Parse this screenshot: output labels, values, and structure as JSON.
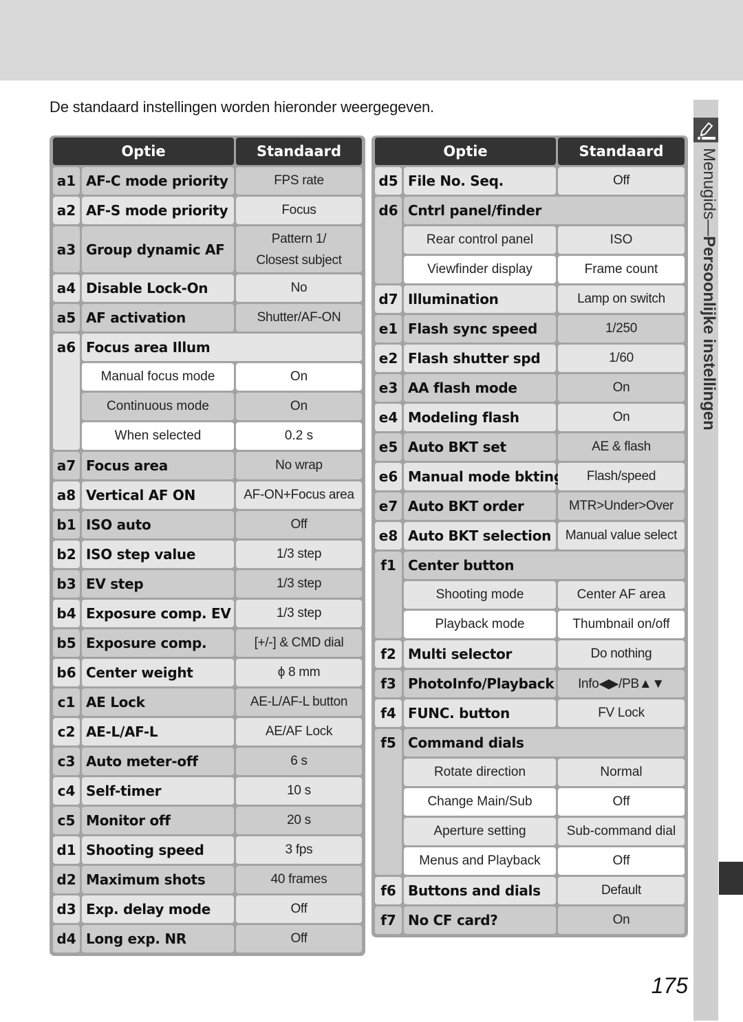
{
  "intro": "De standaard instellingen worden hieronder weergegeven.",
  "headers": {
    "option": "Optie",
    "default": "Standaard"
  },
  "side_tab": {
    "label_light": "Menugids",
    "label_sep": "—",
    "label_bold": "Persoonlijke instellingen",
    "icon": "pencil-menu-icon"
  },
  "page_number": "175",
  "left_table": [
    {
      "id": "a1",
      "name": "AF-C mode priority",
      "value": "FPS rate",
      "shade": "dark"
    },
    {
      "id": "a2",
      "name": "AF-S mode priority",
      "value": "Focus",
      "shade": "light"
    },
    {
      "id": "a3",
      "name": "Group dynamic AF",
      "value": "Pattern 1/",
      "value2": "Closest subject",
      "shade": "dark"
    },
    {
      "id": "a4",
      "name": "Disable Lock-On",
      "value": "No",
      "shade": "light"
    },
    {
      "id": "a5",
      "name": "AF activation",
      "value": "Shutter/AF-ON",
      "shade": "dark"
    },
    {
      "id": "a6",
      "name": "Focus area Illum",
      "shade": "light",
      "subs": [
        {
          "name": "Manual focus mode",
          "value": "On",
          "shade": "white"
        },
        {
          "name": "Continuous mode",
          "value": "On",
          "shade": "dark"
        },
        {
          "name": "When selected",
          "value": "0.2 s",
          "shade": "white"
        }
      ]
    },
    {
      "id": "a7",
      "name": "Focus area",
      "value": "No wrap",
      "shade": "dark"
    },
    {
      "id": "a8",
      "name": "Vertical AF ON",
      "value": "AF-ON+Focus area",
      "shade": "light"
    },
    {
      "id": "b1",
      "name": "ISO auto",
      "value": "Off",
      "shade": "dark"
    },
    {
      "id": "b2",
      "name": "ISO step value",
      "value": "1/3 step",
      "shade": "light"
    },
    {
      "id": "b3",
      "name": "EV step",
      "value": "1/3 step",
      "shade": "dark"
    },
    {
      "id": "b4",
      "name": "Exposure comp. EV",
      "value": "1/3 step",
      "shade": "light"
    },
    {
      "id": "b5",
      "name": "Exposure comp.",
      "value": "[+/-] & CMD dial",
      "shade": "dark"
    },
    {
      "id": "b6",
      "name": "Center weight",
      "value": "ϕ 8 mm",
      "shade": "light"
    },
    {
      "id": "c1",
      "name": "AE Lock",
      "value": "AE-L/AF-L button",
      "shade": "dark"
    },
    {
      "id": "c2",
      "name": "AE-L/AF-L",
      "value": "AE/AF Lock",
      "shade": "light"
    },
    {
      "id": "c3",
      "name": "Auto meter-off",
      "value": "6 s",
      "shade": "dark"
    },
    {
      "id": "c4",
      "name": "Self-timer",
      "value": "10 s",
      "shade": "light"
    },
    {
      "id": "c5",
      "name": "Monitor off",
      "value": "20 s",
      "shade": "dark"
    },
    {
      "id": "d1",
      "name": "Shooting speed",
      "value": "3 fps",
      "shade": "light"
    },
    {
      "id": "d2",
      "name": "Maximum shots",
      "value": "40 frames",
      "shade": "dark"
    },
    {
      "id": "d3",
      "name": "Exp. delay mode",
      "value": "Off",
      "shade": "light"
    },
    {
      "id": "d4",
      "name": "Long exp. NR",
      "value": "Off",
      "shade": "dark"
    }
  ],
  "right_table": [
    {
      "id": "d5",
      "name": "File No. Seq.",
      "value": "Off",
      "shade": "light"
    },
    {
      "id": "d6",
      "name": "Cntrl panel/finder",
      "shade": "dark",
      "subs": [
        {
          "name": "Rear control panel",
          "value": "ISO",
          "shade": "light"
        },
        {
          "name": "Viewfinder display",
          "value": "Frame count",
          "shade": "white"
        }
      ]
    },
    {
      "id": "d7",
      "name": "Illumination",
      "value": "Lamp on switch",
      "shade": "light"
    },
    {
      "id": "e1",
      "name": "Flash sync speed",
      "value": "1/250",
      "shade": "dark"
    },
    {
      "id": "e2",
      "name": "Flash shutter spd",
      "value": "1/60",
      "shade": "light"
    },
    {
      "id": "e3",
      "name": "AA flash mode",
      "value": "On",
      "shade": "dark"
    },
    {
      "id": "e4",
      "name": "Modeling flash",
      "value": "On",
      "shade": "light"
    },
    {
      "id": "e5",
      "name": "Auto BKT set",
      "value": "AE & flash",
      "shade": "dark"
    },
    {
      "id": "e6",
      "name": "Manual mode bkting",
      "value": "Flash/speed",
      "shade": "light"
    },
    {
      "id": "e7",
      "name": "Auto BKT order",
      "value": "MTR>Under>Over",
      "shade": "dark"
    },
    {
      "id": "e8",
      "name": "Auto BKT selection",
      "value": "Manual value select",
      "shade": "light"
    },
    {
      "id": "f1",
      "name": "Center button",
      "shade": "dark",
      "subs": [
        {
          "name": "Shooting mode",
          "value": "Center AF area",
          "shade": "light"
        },
        {
          "name": "Playback mode",
          "value": "Thumbnail on/off",
          "shade": "white"
        }
      ]
    },
    {
      "id": "f2",
      "name": "Multi selector",
      "value": "Do nothing",
      "shade": "light"
    },
    {
      "id": "f3",
      "name": "PhotoInfo/Playback",
      "value": "Info◀▶/PB▲▼",
      "shade": "dark"
    },
    {
      "id": "f4",
      "name": "FUNC. button",
      "value": "FV Lock",
      "shade": "light"
    },
    {
      "id": "f5",
      "name": "Command dials",
      "shade": "dark",
      "subs": [
        {
          "name": "Rotate direction",
          "value": "Normal",
          "shade": "light"
        },
        {
          "name": "Change Main/Sub",
          "value": "Off",
          "shade": "white"
        },
        {
          "name": "Aperture setting",
          "value": "Sub-command dial",
          "shade": "light"
        },
        {
          "name": "Menus and Playback",
          "value": "Off",
          "shade": "white"
        }
      ]
    },
    {
      "id": "f6",
      "name": "Buttons and dials",
      "value": "Default",
      "shade": "light"
    },
    {
      "id": "f7",
      "name": "No CF card?",
      "value": "On",
      "shade": "dark"
    }
  ]
}
